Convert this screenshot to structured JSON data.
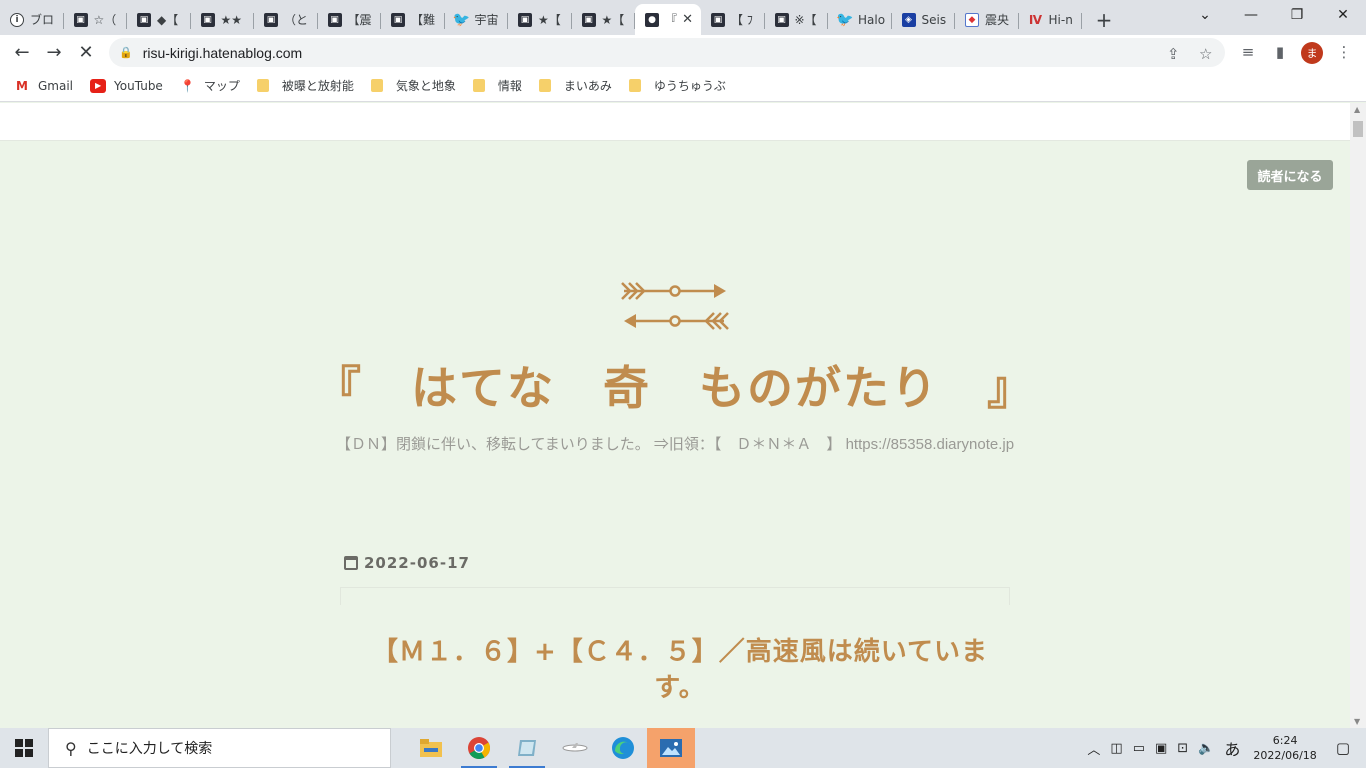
{
  "browser": {
    "tabs": [
      {
        "title": "ブロ",
        "icon": "circle-i-icon"
      },
      {
        "title": "☆（",
        "icon": "blog-icon"
      },
      {
        "title": "◆【",
        "icon": "blog-icon"
      },
      {
        "title": "★★",
        "icon": "blog-icon"
      },
      {
        "title": "（と",
        "icon": "blog-icon"
      },
      {
        "title": "【震",
        "icon": "blog-icon"
      },
      {
        "title": "【難",
        "icon": "blog-icon"
      },
      {
        "title": "宇宙",
        "icon": "twitter-icon"
      },
      {
        "title": "★【",
        "icon": "blog-icon"
      },
      {
        "title": "★【",
        "icon": "blog-icon"
      },
      {
        "title": "『",
        "icon": "loading-icon",
        "active": true
      },
      {
        "title": "【 ﾌ",
        "icon": "blog-icon"
      },
      {
        "title": "※【",
        "icon": "blog-icon"
      },
      {
        "title": "Halo",
        "icon": "twitter-icon"
      },
      {
        "title": "Seis",
        "icon": "seis-icon"
      },
      {
        "title": "震央",
        "icon": "cube-icon"
      },
      {
        "title": "Hi-n",
        "icon": "hinet-icon"
      }
    ],
    "url": "risu-kirigi.hatenablog.com",
    "profile_initial": "ま"
  },
  "bookmarks": [
    {
      "label": "Gmail",
      "icon": "gmail-icon"
    },
    {
      "label": "YouTube",
      "icon": "youtube-icon"
    },
    {
      "label": "マップ",
      "icon": "maps-icon"
    },
    {
      "label": "被曝と放射能",
      "icon": "folder-icon"
    },
    {
      "label": "気象と地象",
      "icon": "folder-icon"
    },
    {
      "label": "情報",
      "icon": "folder-icon"
    },
    {
      "label": "まいあみ",
      "icon": "folder-icon"
    },
    {
      "label": "ゆうちゅうぶ",
      "icon": "folder-icon"
    }
  ],
  "page": {
    "subscribe_label": "読者になる",
    "blog_title": "『　はてな　奇　ものがたり　』",
    "blog_description": "【ＤＮ】閉鎖に伴い、移転してまいりました。 ⇒旧領：【　Ｄ＊Ｎ＊Ａ　】 https://85358.diarynote.jp",
    "entry_date": "2022-06-17",
    "entry_title": "【Ｍ１．６】+【Ｃ４．５】／高速風は続いています。"
  },
  "taskbar": {
    "search_placeholder": "ここに入力して検索",
    "time": "6:24",
    "date": "2022/06/18",
    "ime": "あ"
  },
  "colors": {
    "page_bg": "#ecf4e8",
    "accent": "#c08c4e",
    "subscribe_bg": "#9aa598"
  }
}
